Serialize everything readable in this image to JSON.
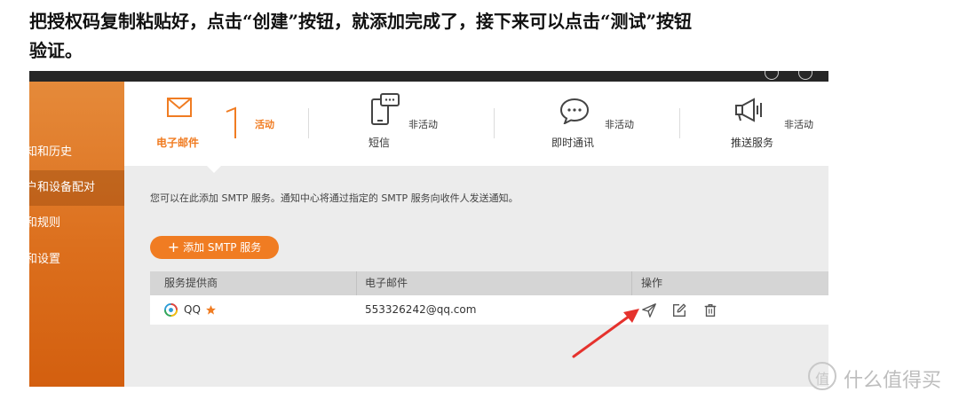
{
  "article": {
    "line1": "把授权码复制粘贴好，点击“创建”按钮，就添加完成了，接下来可以点击“测试”按钮",
    "line2": "验证。"
  },
  "sidebar": {
    "items": [
      {
        "label": "知和历史",
        "active": false
      },
      {
        "label": "户和设备配对",
        "active": true
      },
      {
        "label": "和规则",
        "active": false
      },
      {
        "label": "和设置",
        "active": false
      }
    ]
  },
  "tabs": [
    {
      "name": "电子邮件",
      "status": "活动",
      "icon": "email-icon",
      "active": true
    },
    {
      "name": "短信",
      "status": "非活动",
      "icon": "sms-icon",
      "active": false
    },
    {
      "name": "即时通讯",
      "status": "非活动",
      "icon": "chat-icon",
      "active": false
    },
    {
      "name": "推送服务",
      "status": "非活动",
      "icon": "megaphone-icon",
      "active": false
    }
  ],
  "main": {
    "description": "您可以在此添加 SMTP 服务。通知中心将通过指定的 SMTP 服务向收件人发送通知。",
    "add_button": "添加 SMTP 服务"
  },
  "table": {
    "columns": [
      "服务提供商",
      "电子邮件",
      "操作"
    ],
    "rows": [
      {
        "provider": "QQ",
        "email": "553326242@qq.com",
        "starred": true
      }
    ],
    "actions": [
      "send-test-icon",
      "edit-icon",
      "trash-icon"
    ]
  },
  "colors": {
    "accent": "#f07c22",
    "annotation_arrow": "#e5322d"
  },
  "watermark": {
    "text": "什么值得买",
    "logo_glyph": "值"
  }
}
